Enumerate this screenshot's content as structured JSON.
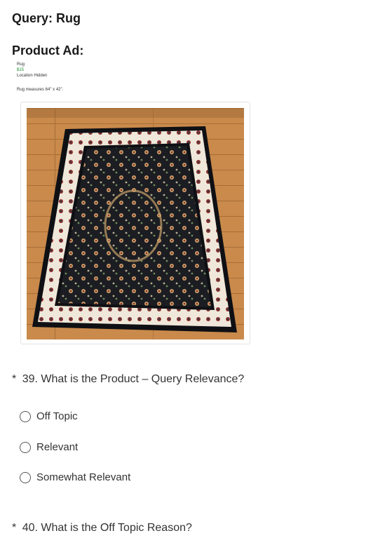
{
  "query": {
    "label": "Query: Rug"
  },
  "product_ad": {
    "heading": "Product Ad:",
    "title": "Rug",
    "price": "$15",
    "location": "Location Hidden",
    "description": "Rug measures 64\" x 42\"."
  },
  "questions": [
    {
      "required_marker": "*",
      "text": "39. What is the Product – Query Relevance?",
      "options": [
        "Off Topic",
        "Relevant",
        "Somewhat Relevant"
      ]
    },
    {
      "required_marker": "*",
      "text": "40. What is the Off Topic Reason?"
    }
  ],
  "colors": {
    "price": "#1a8f2e",
    "floor": "#c98a4b",
    "rug_field": "#1b1d22",
    "rug_border": "#efe8da"
  }
}
